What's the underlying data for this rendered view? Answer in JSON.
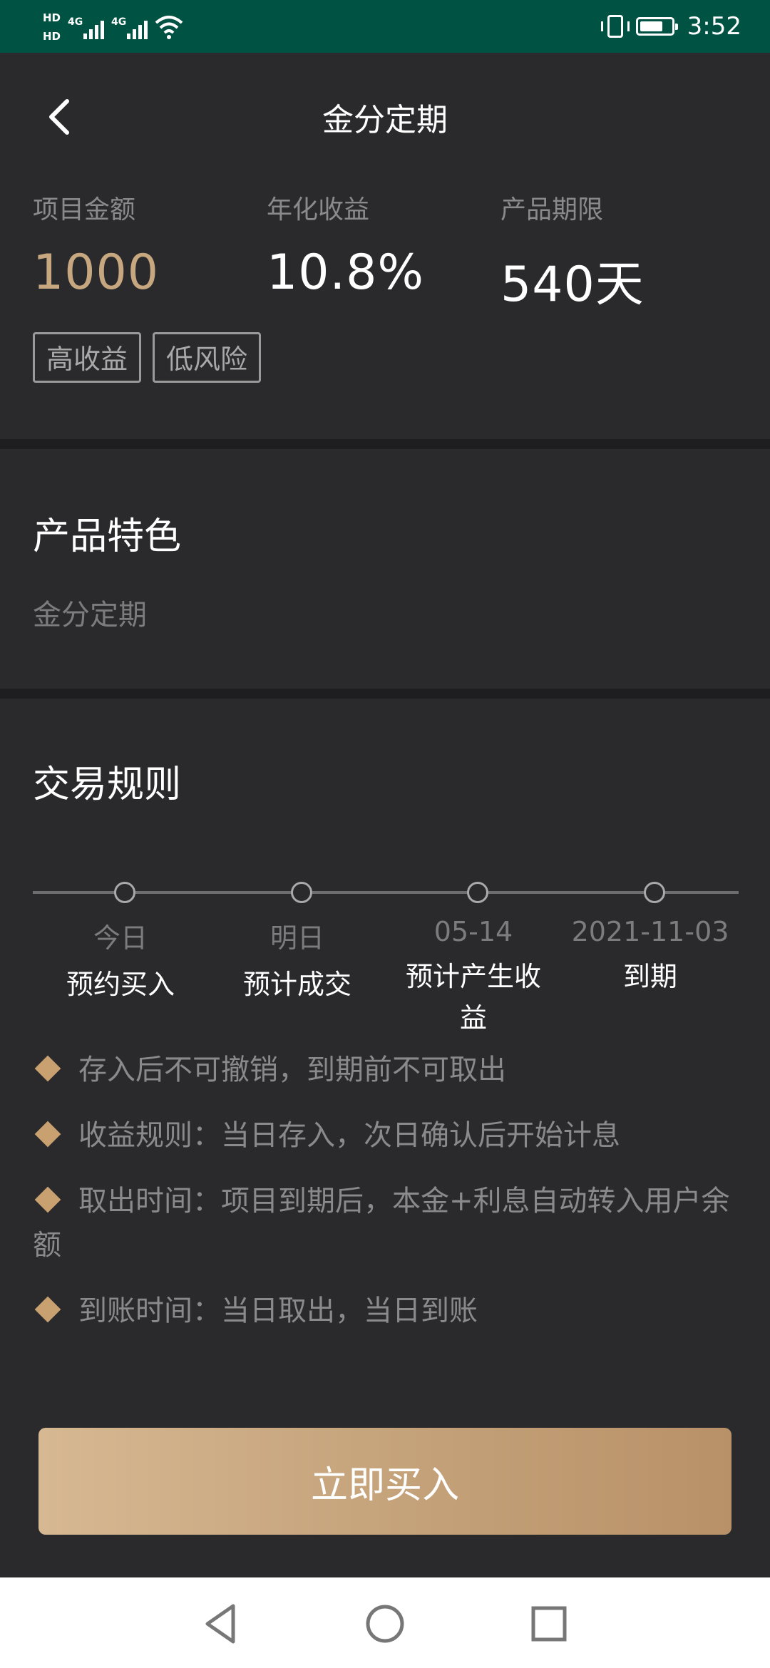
{
  "status_bar": {
    "hd1": "HD",
    "hd2": "HD",
    "net1": "4G",
    "net2": "4G",
    "time": "3:52",
    "battery_level": 0.75,
    "icons": [
      "signal-icon",
      "wifi-icon",
      "vibrate-icon",
      "battery-icon"
    ]
  },
  "header": {
    "title": "金分定期",
    "back_icon": "chevron-left-icon"
  },
  "stats": [
    {
      "label": "项目金额",
      "value": "1000",
      "color": "#c7a77f"
    },
    {
      "label": "年化收益",
      "value": "10.8%",
      "color": "#ffffff"
    },
    {
      "label": "产品期限",
      "value": "540天",
      "color": "#ffffff"
    }
  ],
  "tags": [
    "高收益",
    "低风险"
  ],
  "features": {
    "title": "产品特色",
    "text": "金分定期"
  },
  "rules_section": {
    "title": "交易规则",
    "timeline": [
      {
        "date": "今日",
        "event": "预约买入"
      },
      {
        "date": "明日",
        "event": "预计成交"
      },
      {
        "date": "05-14",
        "event": "预计产生收益"
      },
      {
        "date": "2021-11-03",
        "event": "到期"
      }
    ],
    "rules": [
      "存入后不可撤销，到期前不可取出",
      "收益规则：当日存入，次日确认后开始计息",
      "取出时间：项目到期后，本金+利息自动转入用户余额",
      "到账时间：当日取出，当日到账"
    ]
  },
  "buy_button": "立即买入",
  "nav": [
    "back-icon",
    "home-icon",
    "recents-icon"
  ],
  "colors": {
    "accent": "#c9a070",
    "background": "#2a2a2c",
    "status_bar": "#005243"
  }
}
